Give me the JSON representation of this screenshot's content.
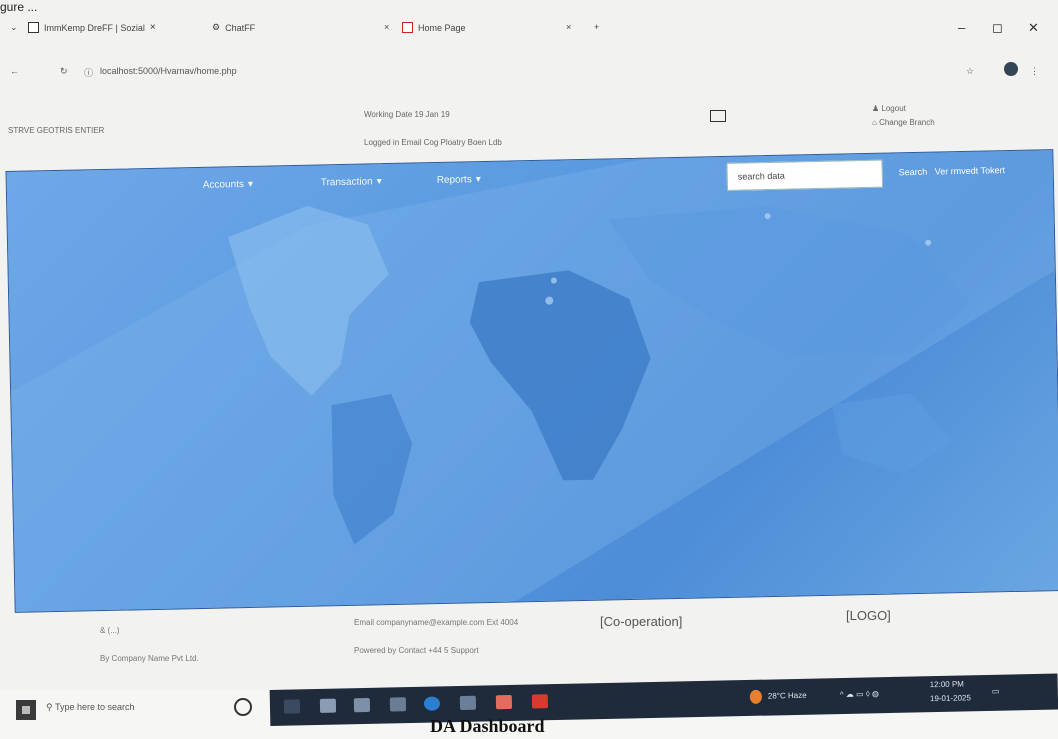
{
  "caption": "gure ...",
  "browser": {
    "tabs": [
      {
        "label": "ImmKemp DreFF | Sozial"
      },
      {
        "label": "ChatFF"
      },
      {
        "label": "Home Page"
      }
    ],
    "url": "localhost:5000/Hvarnav/home.php",
    "window_controls": {
      "minimize": "–",
      "restore": "◻",
      "close": "✕"
    }
  },
  "header": {
    "brand": "STRVE GEOTRIS ENTIER",
    "date_line": "Working Date 19 Jan 19",
    "login_line": "Logged in Email Cog Ploatry Boen Ldb",
    "logout": "Logout",
    "change_branch": "Change Branch"
  },
  "nav": {
    "accounts": "Accounts",
    "transaction": "Transaction",
    "reports": "Reports"
  },
  "search": {
    "value": "search data",
    "search_label": "Search",
    "extra_label": "Ver rmvedt Tokert"
  },
  "footer": {
    "left_line1": "& (...)",
    "left_line2": "By Company Name Pvt Ltd.",
    "mid_line1": "Email companyname@example.com Ext 4004",
    "mid_line2": "Powered by  Contact +44 5  Support",
    "cooperation": "[Co-operation]",
    "logo": "[LOGO]"
  },
  "taskbar": {
    "search_placeholder": "Type here to search",
    "weather": "28°C Haze",
    "time": "12:00 PM",
    "date": "19-01-2025"
  },
  "below_text": "DA Dashboard"
}
